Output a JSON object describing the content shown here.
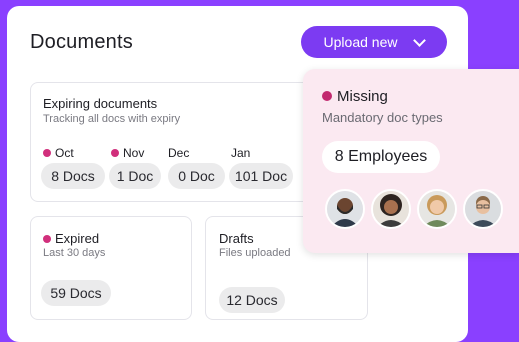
{
  "header": {
    "title": "Documents",
    "upload_label": "Upload new"
  },
  "expiring": {
    "title": "Expiring documents",
    "subtitle": "Tracking all docs with expiry",
    "months": [
      {
        "label": "Oct",
        "count": "8 Docs"
      },
      {
        "label": "Nov",
        "count": "1 Doc"
      },
      {
        "label": "Dec",
        "count": "0 Doc"
      },
      {
        "label": "Jan",
        "count": "101 Doc"
      }
    ]
  },
  "expired": {
    "title": "Expired",
    "subtitle": "Last 30 days",
    "count": "59 Docs"
  },
  "drafts": {
    "title": "Drafts",
    "subtitle": "Files uploaded",
    "count": "12 Docs"
  },
  "missing": {
    "title": "Missing",
    "subtitle": "Mandatory doc types",
    "count": "8 Employees",
    "avatars": [
      "employee-avatar-1",
      "employee-avatar-2",
      "employee-avatar-3",
      "employee-avatar-4"
    ]
  },
  "colors": {
    "background": "#8a40ff",
    "accent": "#7c3bf2",
    "status_dot": "#d12f7c",
    "missing_card": "#fbe9f1"
  }
}
